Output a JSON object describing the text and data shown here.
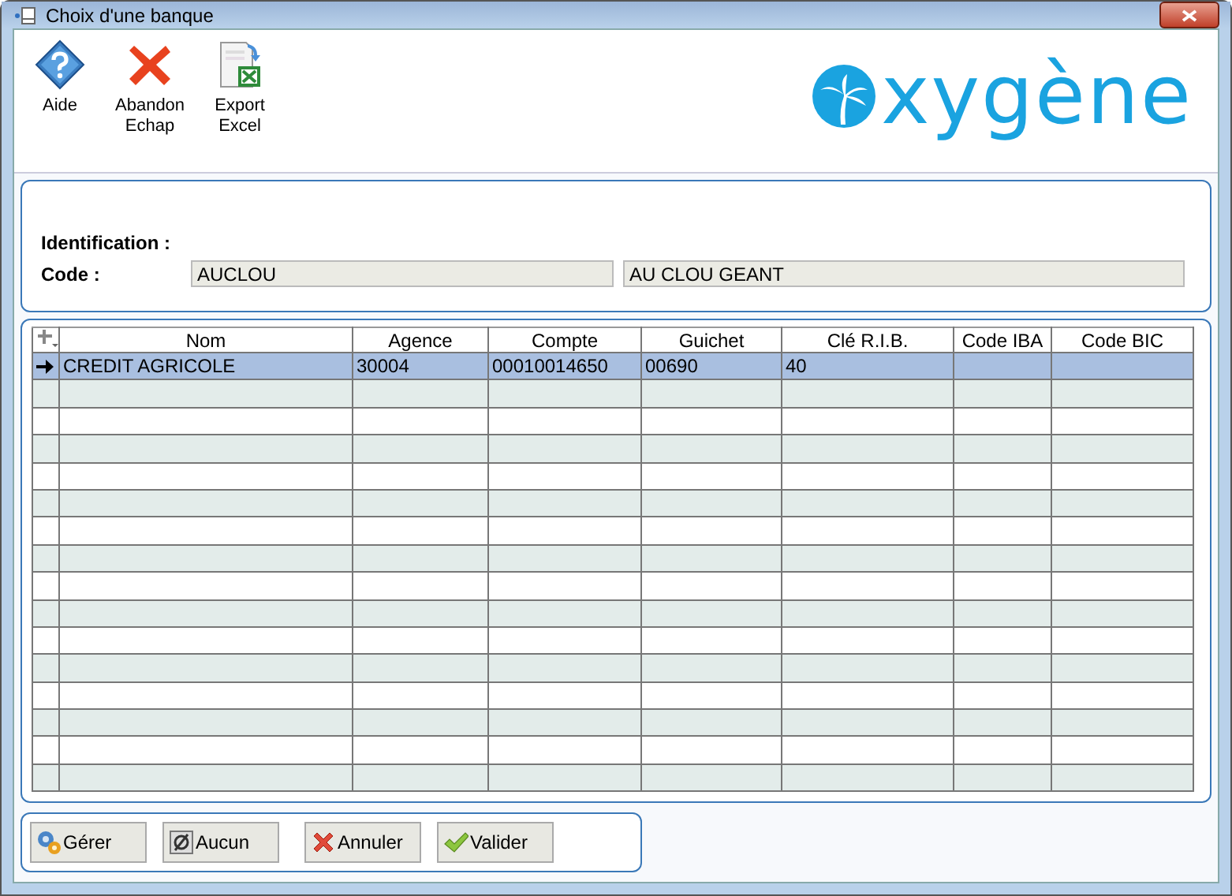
{
  "window": {
    "title": "Choix d'une banque"
  },
  "toolbar": [
    {
      "kind": "help",
      "label": "Aide"
    },
    {
      "kind": "cancel",
      "label": "Abandon\nEchap"
    },
    {
      "kind": "excel",
      "label": "Export\nExcel"
    }
  ],
  "logo": "xygène",
  "form": {
    "heading": "Identification :",
    "code_label": "Code :",
    "code": "AUCLOU",
    "name": "AU CLOU GEANT"
  },
  "table": {
    "columns": [
      "Nom",
      "Agence",
      "Compte",
      "Guichet",
      "Clé R.I.B.",
      "Code IBA",
      "Code BIC"
    ],
    "rows": [
      {
        "selected": true,
        "cells": [
          "CREDIT AGRICOLE",
          "30004",
          "00010014650",
          "00690",
          "40",
          "",
          ""
        ]
      }
    ]
  },
  "buttons": [
    {
      "kind": "manage",
      "label": "Gérer"
    },
    {
      "kind": "none",
      "label": "Aucun"
    },
    {
      "kind": "cancel",
      "label": "Annuler"
    },
    {
      "kind": "ok",
      "label": "Valider"
    }
  ]
}
